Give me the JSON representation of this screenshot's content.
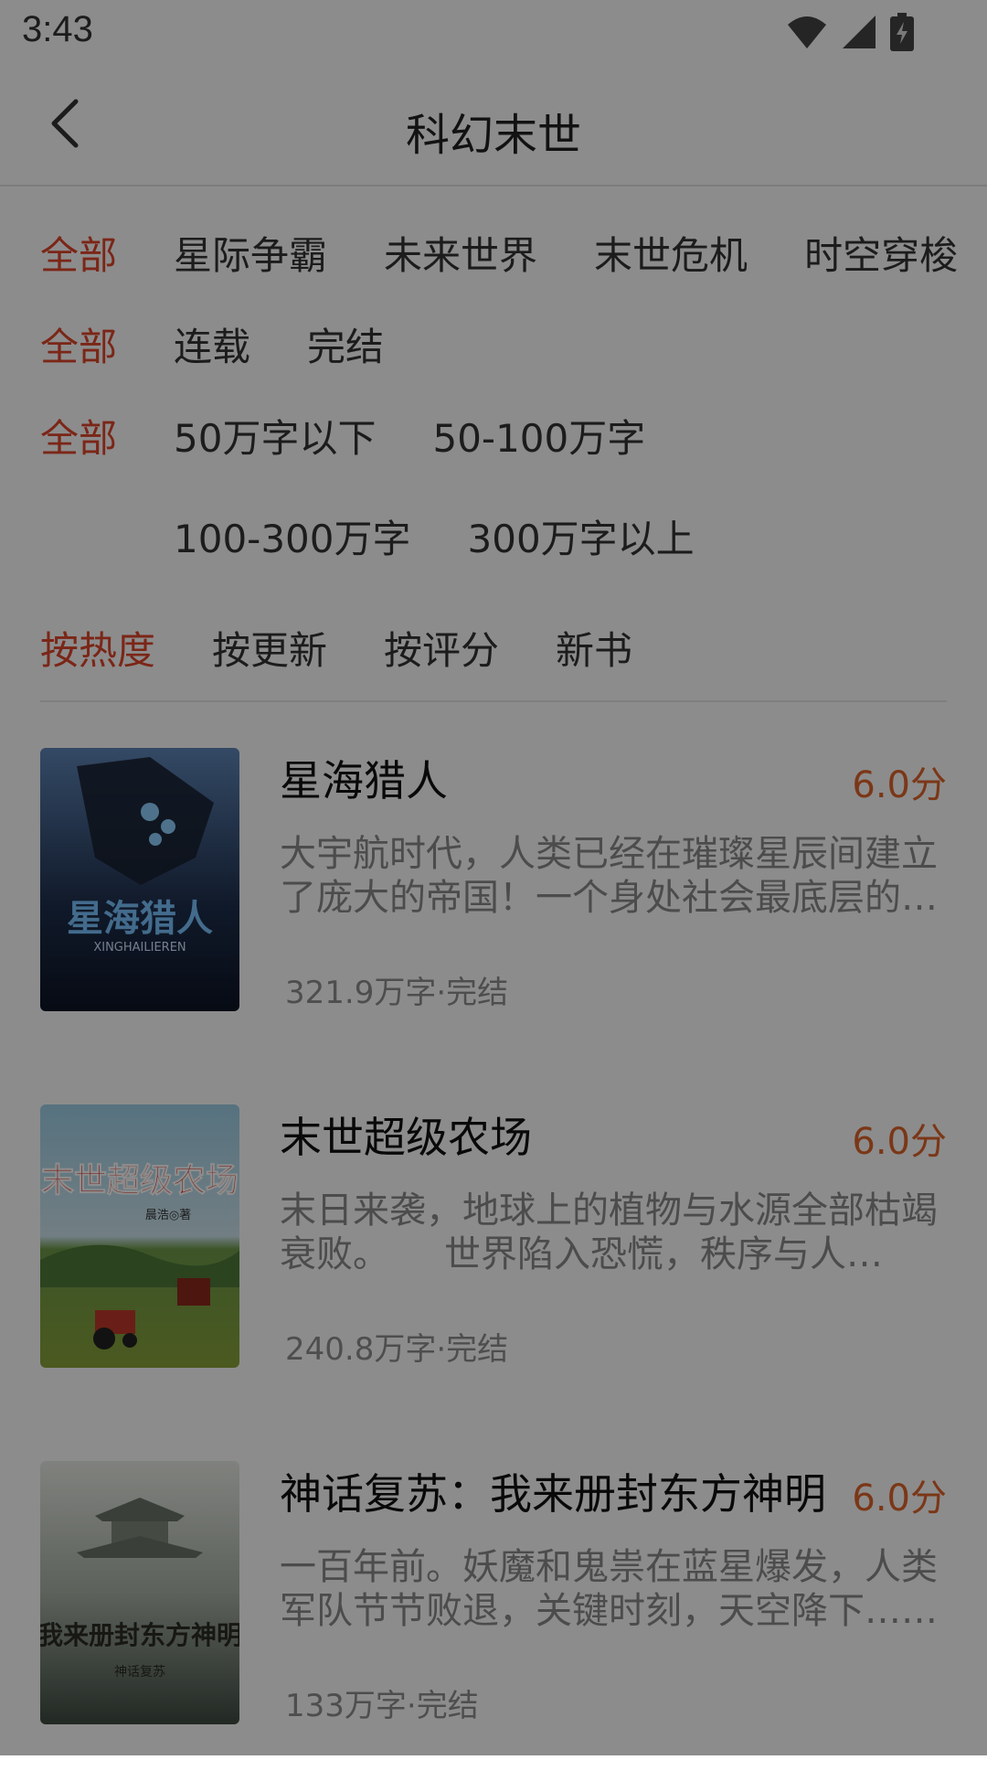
{
  "status": {
    "time": "3:43"
  },
  "header": {
    "title": "科幻末世"
  },
  "filters": {
    "category": [
      "全部",
      "星际争霸",
      "未来世界",
      "末世危机",
      "时空穿梭"
    ],
    "status": [
      "全部",
      "连载",
      "完结"
    ],
    "length": [
      "全部",
      "50万字以下",
      "50-100万字",
      "100-300万字",
      "300万字以上"
    ],
    "sort": [
      "按热度",
      "按更新",
      "按评分",
      "新书"
    ]
  },
  "books": [
    {
      "title": "星海猎人",
      "score": "6.0分",
      "desc": "大宇航时代，人类已经在璀璨星辰间建立了庞大的帝国！一个身处社会最底层的少年……",
      "meta": "321.9万字·完结",
      "cover_text": "星海猎人",
      "cover_sub": "XINGHAILIEREN"
    },
    {
      "title": "末世超级农场",
      "score": "6.0分",
      "desc": "末日来袭，地球上的植物与水源全部枯竭衰败。　　世界陷入恐慌，秩序与人性……",
      "meta": "240.8万字·完结",
      "cover_text": "末世超级农场",
      "cover_sub": "晨浩◎著"
    },
    {
      "title": "神话复苏：我来册封东方神明",
      "score": "6.0分",
      "desc": "一百年前。妖魔和鬼祟在蓝星爆发，人类军队节节败退，关键时刻，天空降下……",
      "meta": "133万字·完结",
      "cover_text": "我来册封东方神明",
      "cover_sub": "神话复苏"
    }
  ],
  "colors": {
    "accent": "#e0452b",
    "score": "#e0652b"
  }
}
